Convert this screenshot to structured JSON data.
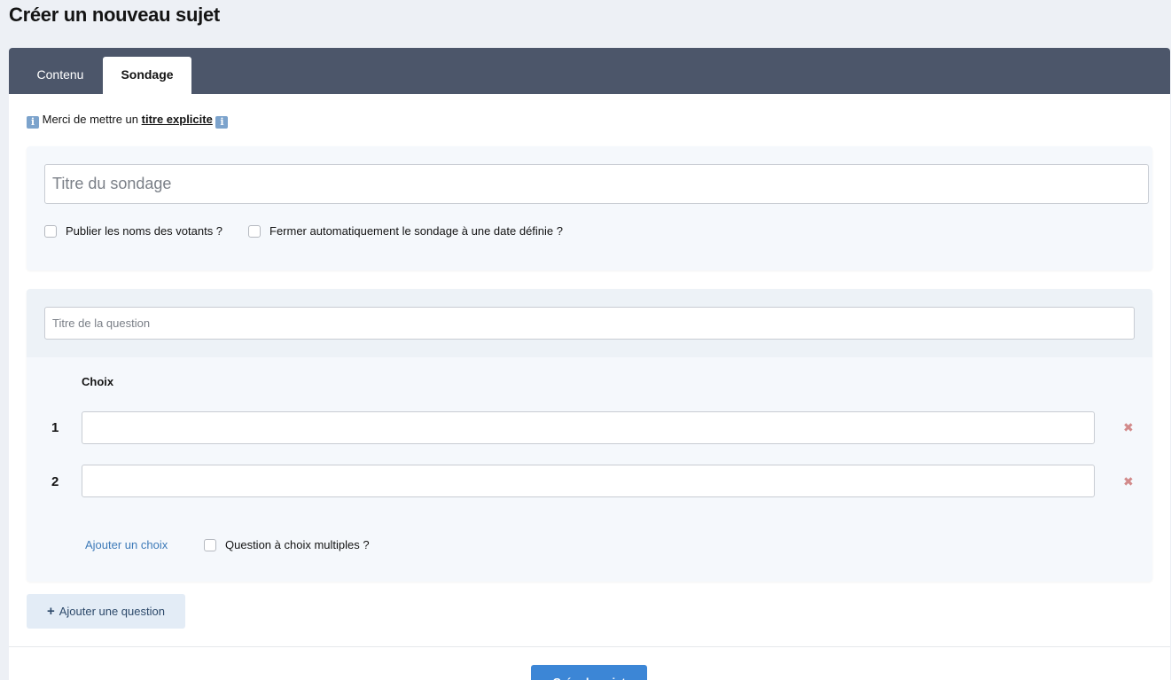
{
  "page": {
    "title": "Créer un nouveau sujet"
  },
  "tabs": [
    {
      "label": "Contenu",
      "active": false
    },
    {
      "label": "Sondage",
      "active": true
    }
  ],
  "info": {
    "prefix": "Merci de mettre un",
    "emphasis": "titre explicite",
    "icon": "i"
  },
  "poll": {
    "title_placeholder": "Titre du sondage",
    "options": [
      {
        "label": "Publier les noms des votants ?",
        "checked": false
      },
      {
        "label": "Fermer automatiquement le sondage à une date définie ?",
        "checked": false
      }
    ]
  },
  "question": {
    "title_placeholder": "Titre de la question",
    "choices_header": "Choix",
    "choices": [
      {
        "number": "1",
        "value": ""
      },
      {
        "number": "2",
        "value": ""
      }
    ],
    "delete_icon": "✖",
    "add_choice_label": "Ajouter un choix",
    "multiple_label": "Question à choix multiples ?"
  },
  "actions": {
    "add_question_icon": "+",
    "add_question_label": "Ajouter une question",
    "submit_label": "Créer le sujet"
  },
  "colors": {
    "tabbar": "#4c566a",
    "accent": "#3c86d6",
    "link": "#3d7ab8",
    "delete": "#d28a8a"
  }
}
